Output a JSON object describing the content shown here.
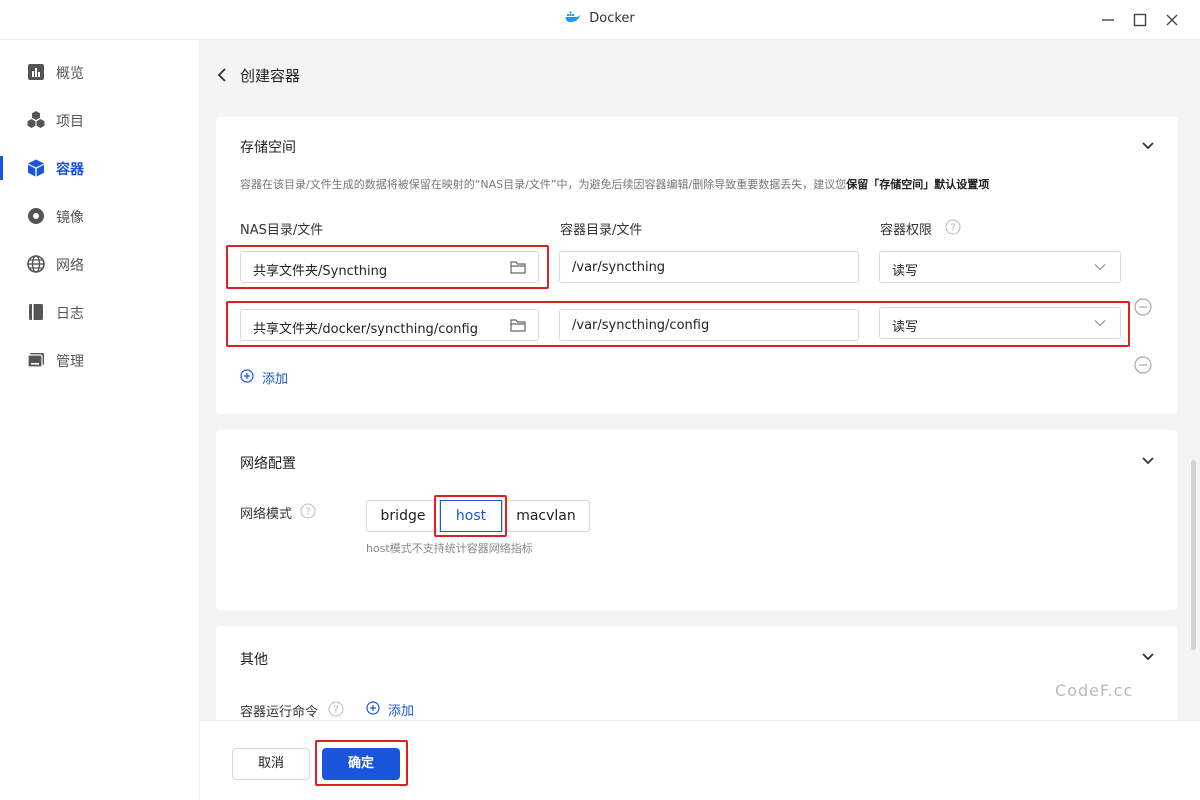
{
  "window": {
    "title": "Docker"
  },
  "sidebar": {
    "items": [
      {
        "label": "概览",
        "icon": "overview-icon"
      },
      {
        "label": "项目",
        "icon": "project-icon"
      },
      {
        "label": "容器",
        "icon": "container-icon",
        "active": true
      },
      {
        "label": "镜像",
        "icon": "image-icon"
      },
      {
        "label": "网络",
        "icon": "network-icon"
      },
      {
        "label": "日志",
        "icon": "log-icon"
      },
      {
        "label": "管理",
        "icon": "manage-icon"
      }
    ]
  },
  "header": {
    "title": "创建容器"
  },
  "storage": {
    "title": "存储空间",
    "hint": "容器在该目录/文件生成的数据将被保留在映射的“NAS目录/文件”中，为避免后续因容器编辑/删除导致重要数据丢失，建议您",
    "hint_bold": "保留「存储空间」默认设置项",
    "col_nas": "NAS目录/文件",
    "col_container": "容器目录/文件",
    "col_perm": "容器权限",
    "rows": [
      {
        "nas": "共享文件夹/Syncthing",
        "container": "/var/syncthing",
        "perm": "读写"
      },
      {
        "nas": "共享文件夹/docker/syncthing/config",
        "container": "/var/syncthing/config",
        "perm": "读写"
      }
    ],
    "add_label": "添加"
  },
  "network": {
    "title": "网络配置",
    "mode_label": "网络模式",
    "modes": [
      "bridge",
      "host",
      "macvlan"
    ],
    "selected": "host",
    "mode_hint": "host模式不支持统计容器网络指标"
  },
  "other": {
    "title": "其他",
    "cmd_label": "容器运行命令",
    "add_label": "添加"
  },
  "footer": {
    "cancel": "取消",
    "confirm": "确定"
  },
  "watermark": "CodeF.cc",
  "colors": {
    "accent": "#1a56db",
    "highlight": "#e02020"
  }
}
